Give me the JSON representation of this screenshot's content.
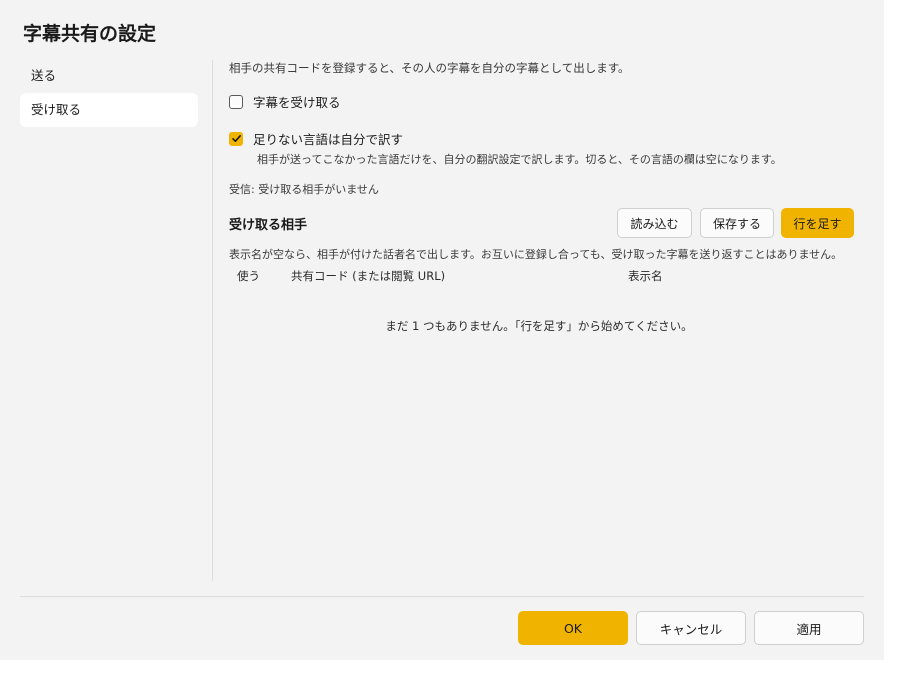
{
  "dialog": {
    "title": "字幕共有の設定"
  },
  "sidebar": {
    "items": [
      {
        "label": "送る",
        "active": false
      },
      {
        "label": "受け取る",
        "active": true
      }
    ]
  },
  "main": {
    "description": "相手の共有コードを登録すると、その人の字幕を自分の字幕として出します。",
    "receive_checkbox": {
      "label": "字幕を受け取る",
      "checked": false
    },
    "translate_checkbox": {
      "label": "足りない言語は自分で訳す",
      "checked": true
    },
    "translate_note": "相手が送ってこなかった言語だけを、自分の翻訳設定で訳します。切ると、その言語の欄は空になります。",
    "status": "受信: 受け取る相手がいません",
    "section_title": "受け取る相手",
    "load_button": "読み込む",
    "save_button": "保存する",
    "add_row_button": "行を足す",
    "section_note": "表示名が空なら、相手が付けた話者名で出します。お互いに登録し合っても、受け取った字幕を送り返すことはありません。",
    "table": {
      "columns": [
        "使う",
        "共有コード (または閲覧 URL)",
        "表示名"
      ],
      "rows": [],
      "empty_message": "まだ 1 つもありません。「行を足す」から始めてください。"
    }
  },
  "footer": {
    "ok": "OK",
    "cancel": "キャンセル",
    "apply": "適用"
  },
  "colors": {
    "accent": "#f0b400",
    "window_background": "#f3f3f3"
  }
}
